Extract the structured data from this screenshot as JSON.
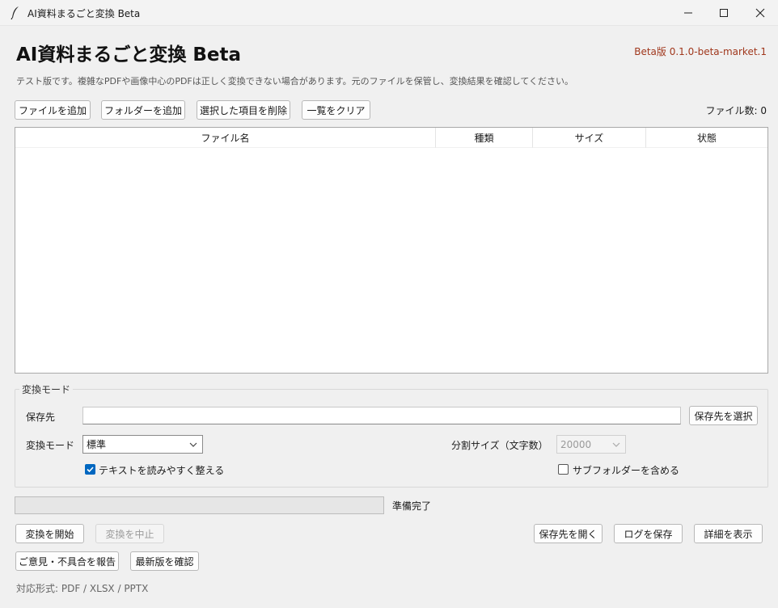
{
  "window": {
    "title": "AI資料まるごと変換 Beta"
  },
  "header": {
    "app_title": "AI資料まるごと変換 Beta",
    "version": "Beta版  0.1.0-beta-market.1",
    "notice": "テスト版です。複雑なPDFや画像中心のPDFは正しく変換できない場合があります。元のファイルを保管し、変換結果を確認してください。"
  },
  "toolbar": {
    "add_files": "ファイルを追加",
    "add_folder": "フォルダーを追加",
    "remove_selected": "選択した項目を削除",
    "clear_list": "一覧をクリア",
    "file_count": "ファイル数: 0"
  },
  "table": {
    "columns": [
      "ファイル名",
      "種類",
      "サイズ",
      "状態"
    ],
    "rows": []
  },
  "settings": {
    "group_label": "変換モード",
    "output_label": "保存先",
    "output_value": "",
    "choose_output": "保存先を選択",
    "mode_label": "変換モード",
    "mode_value": "標準",
    "split_label": "分割サイズ（文字数）",
    "split_value": "20000",
    "tidy_text_label": "テキストを読みやすく整える",
    "tidy_text_checked": true,
    "include_subfolders_label": "サブフォルダーを含める",
    "include_subfolders_checked": false
  },
  "progress": {
    "value": 0,
    "status": "準備完了"
  },
  "actions": {
    "start": "変換を開始",
    "stop": "変換を中止",
    "open_output": "保存先を開く",
    "save_log": "ログを保存",
    "show_details": "詳細を表示",
    "feedback": "ご意見・不具合を報告",
    "check_update": "最新版を確認"
  },
  "footer": {
    "formats": "対応形式: PDF / XLSX / PPTX"
  },
  "colors": {
    "accent": "#0067c0",
    "version_text": "#a0371c"
  }
}
